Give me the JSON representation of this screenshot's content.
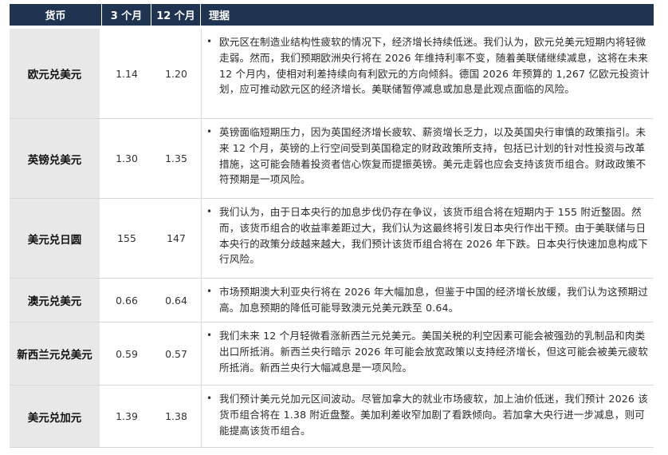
{
  "header": {
    "currency": "货币",
    "m3": "3 个月",
    "m12": "12 个月",
    "rationale": "理据"
  },
  "rows": [
    {
      "currency": "欧元兑美元",
      "m3": "1.14",
      "m12": "1.20",
      "rationale": "欧元区在制造业结构性疲软的情况下，经济增长持续低迷。我们认为，欧元兑美元短期内将轻微走弱。然而，我们预期欧洲央行将在 2026 年维持利率不变，随着美联储继续减息，这将在未来 12 个月内，使相对利差持续向有利欧元的方向倾斜。德国 2026 年预算的 1,267 亿欧元投资计划，应可推动欧元区的经济增长。美联储暂停减息或加息是此观点面临的风险。"
    },
    {
      "currency": "英镑兑美元",
      "m3": "1.30",
      "m12": "1.35",
      "rationale": "英镑面临短期压力，因为英国经济增长疲软、薪资增长乏力，以及英国央行审慎的政策指引。未来 12 个月，英镑的上行空间受到英国稳定的财政政策所支持，包括已计划的针对性投资与改革措施，这可能会随着投资者信心恢复而提振英镑。美元走弱也应会支持该货币组合。财政政策不符预期是一项风险。"
    },
    {
      "currency": "美元兑日圆",
      "m3": "155",
      "m12": "147",
      "rationale": "我们认为，由于日本央行的加息步伐仍存在争议，该货币组合将在短期内于 155 附近整固。然而，该货币组合的收益率差距过大，我们认为这最终将引发日本央行作出干预。由于美联储与日本央行的政策分歧越来越大，我们预计该货币组合将在 2026 年下跌。日本央行快速加息构成下行风险。"
    },
    {
      "currency": "澳元兑美元",
      "m3": "0.66",
      "m12": "0.64",
      "rationale": "市场预期澳大利亚央行将在 2026 年大幅加息，但鉴于中国的经济增长放缓，我们认为这预期过高。加息预期的降低可能导致澳元兑美元跌至 0.64。"
    },
    {
      "currency": "新西兰元兑美元",
      "m3": "0.59",
      "m12": "0.57",
      "rationale": "我们未来 12 个月轻微看涨新西兰元兑美元。美国关税的利空因素可能会被强劲的乳制品和肉类出口所抵消。新西兰央行暗示 2026 年可能会放宽政策以支持经济增长，但这可能会被美元疲软所抵消。新西兰央行大幅减息是一项风险。"
    },
    {
      "currency": "美元兑加元",
      "m3": "1.39",
      "m12": "1.38",
      "rationale": "我们预计美元兑加元区间波动。尽管加拿大的就业市场疲软，加上油价低迷，我们预计 2026 该货币组合将在 1.38 附近盘整。美加利差收窄加剧了看跌倾向。若加拿大央行进一步减息，则可能提高该货币组合。"
    }
  ]
}
